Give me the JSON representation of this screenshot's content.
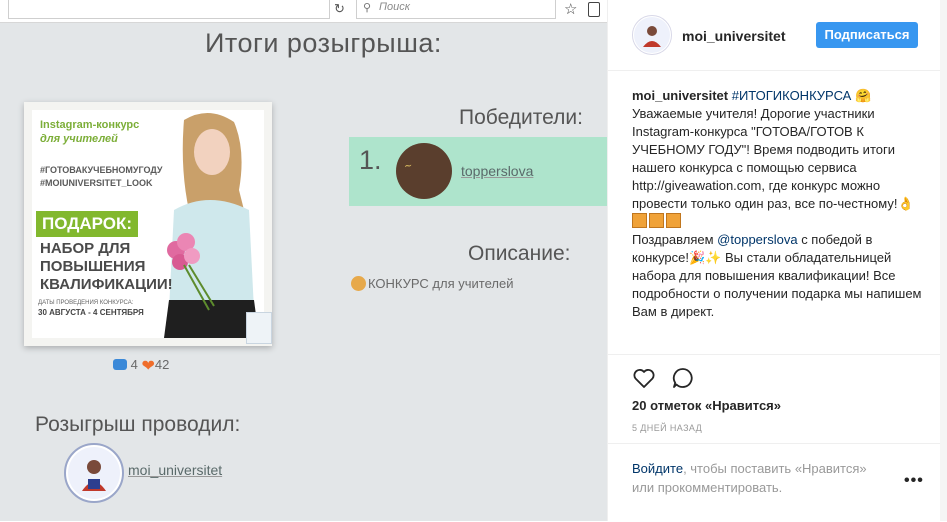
{
  "browser": {
    "reload_icon": "reload-icon",
    "search_placeholder": "Поиск",
    "star_icon": "star-icon"
  },
  "image": {
    "results_title": "Итоги розыгрыша:",
    "poster": {
      "title_line1": "Instagram-конкурс",
      "title_line2": "для учителей",
      "hashtags": [
        "#ГОТОВАКУЧЕБНОМУГОДУ",
        "#MOIUNIVERSITET_LOOK"
      ],
      "gift_label": "ПОДАРОК:",
      "prize_lines": [
        "НАБОР ДЛЯ",
        "ПОВЫШЕНИЯ",
        "КВАЛИФИКАЦИИ!"
      ],
      "dates_label": "ДАТЫ ПРОВЕДЕНИЯ КОНКУРСА:",
      "dates": "30 АВГУСТА - 4 СЕНТЯБРЯ"
    },
    "comments_count": "4",
    "likes_count": "42",
    "winners_heading": "Победители:",
    "winner_number": "1.",
    "winner_name": "topperslova",
    "description_heading": "Описание:",
    "description_text": "КОНКУРС для учителей",
    "held_by_heading": "Розыгрыш проводил:",
    "held_by_name": "moi_universitet"
  },
  "post": {
    "username": "moi_universitet",
    "follow_label": "Подписаться",
    "caption_user": "moi_universitet",
    "caption_hashtag": "#ИТОГИКОНКУРСА",
    "caption_p1": "Уважаемые учителя! Дорогие участники Instagram-конкурса \"ГОТОВА/ГОТОВ К УЧЕБНОМУ ГОДУ\"! Время подводить итоги нашего конкурса с помощью сервиса http://giveawation.com, где конкурс можно провести только один раз, все по-честному!👌",
    "caption_p2a": "Поздравляем ",
    "caption_mention": "@topperslova",
    "caption_p2b": " с победой в конкурсе!🎉✨ Вы стали обладательницей набора для повышения квалификации! Все подробности о получении подарка мы напишем Вам в директ.",
    "likes_text": "20 отметок «Нравится»",
    "time_ago": "5 ДНЕЙ НАЗАД",
    "login_link": "Войдите",
    "login_rest": ", чтобы поставить «Нравится» или прокомментировать.",
    "more_label": "•••"
  },
  "colors": {
    "accent_blue": "#3897f0",
    "winner_strip": "#aee4cc",
    "poster_green": "#82b82e"
  }
}
